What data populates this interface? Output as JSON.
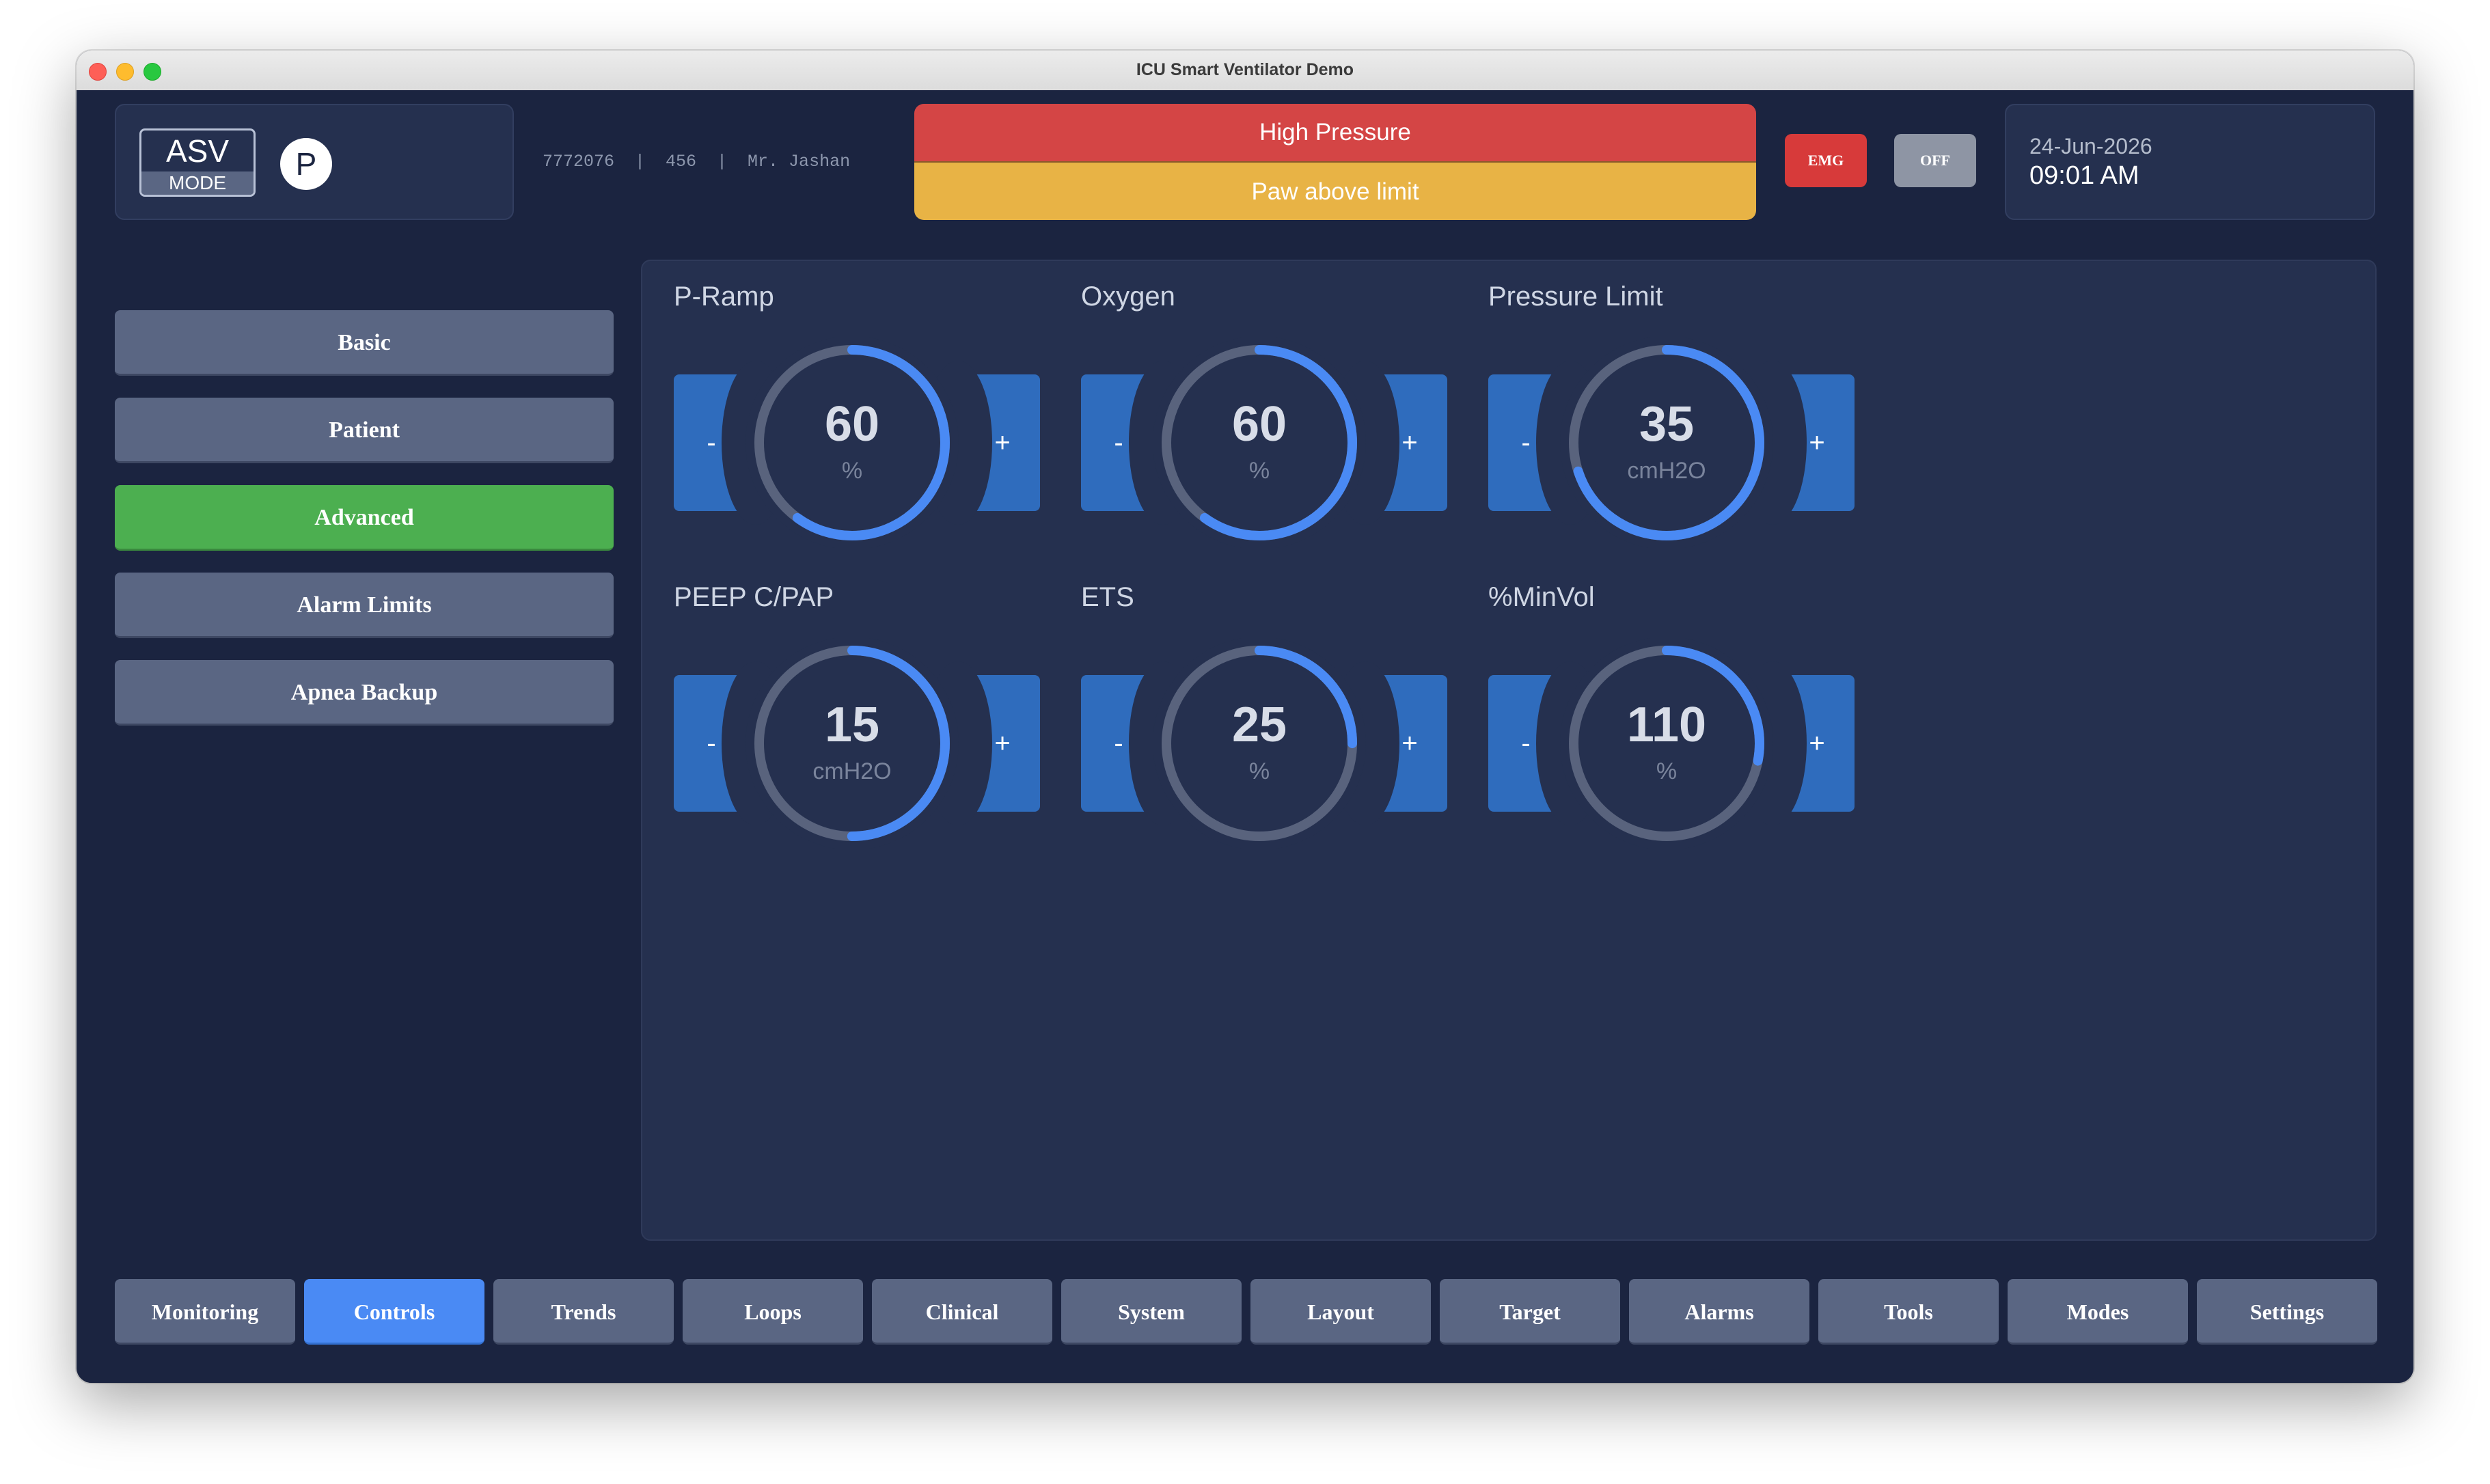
{
  "window": {
    "title": "ICU Smart Ventilator Demo"
  },
  "header": {
    "mode_name": "ASV",
    "mode_label": "MODE",
    "mode_badge_letter": "P",
    "patient_info": "7772076  |  456  |  Mr. Jashan",
    "alarm_primary": "High Pressure",
    "alarm_secondary": "Paw above limit",
    "emg_label": "EMG",
    "off_label": "OFF",
    "date": "24-Jun-2026",
    "time": "09:01 AM"
  },
  "sidebar": {
    "items": [
      {
        "label": "Basic",
        "active": false
      },
      {
        "label": "Patient",
        "active": false
      },
      {
        "label": "Advanced",
        "active": true
      },
      {
        "label": "Alarm Limits",
        "active": false
      },
      {
        "label": "Apnea Backup",
        "active": false
      }
    ]
  },
  "controls": [
    {
      "title": "P-Ramp",
      "value": "60",
      "unit": "%",
      "fill": 0.6,
      "minus": "-",
      "plus": "+"
    },
    {
      "title": "Oxygen",
      "value": "60",
      "unit": "%",
      "fill": 0.6,
      "minus": "-",
      "plus": "+"
    },
    {
      "title": "Pressure Limit",
      "value": "35",
      "unit": "cmH2O",
      "fill": 0.7,
      "minus": "-",
      "plus": "+"
    },
    {
      "title": "PEEP C/PAP",
      "value": "15",
      "unit": "cmH2O",
      "fill": 0.5,
      "minus": "-",
      "plus": "+"
    },
    {
      "title": "ETS",
      "value": "25",
      "unit": "%",
      "fill": 0.25,
      "minus": "-",
      "plus": "+"
    },
    {
      "title": "%MinVol",
      "value": "110",
      "unit": "%",
      "fill": 0.28,
      "minus": "-",
      "plus": "+"
    }
  ],
  "bottom_nav": [
    {
      "label": "Monitoring",
      "active": false
    },
    {
      "label": "Controls",
      "active": true
    },
    {
      "label": "Trends",
      "active": false
    },
    {
      "label": "Loops",
      "active": false
    },
    {
      "label": "Clinical",
      "active": false
    },
    {
      "label": "System",
      "active": false
    },
    {
      "label": "Layout",
      "active": false
    },
    {
      "label": "Target",
      "active": false
    },
    {
      "label": "Alarms",
      "active": false
    },
    {
      "label": "Tools",
      "active": false
    },
    {
      "label": "Modes",
      "active": false
    },
    {
      "label": "Settings",
      "active": false
    }
  ],
  "colors": {
    "background": "#1b2440",
    "panel": "#25304f",
    "accent_blue": "#4a8af4",
    "active_green": "#4caf50",
    "alarm_red": "#d44545",
    "alarm_yellow": "#e8b345",
    "gauge_track": "#59637d"
  }
}
